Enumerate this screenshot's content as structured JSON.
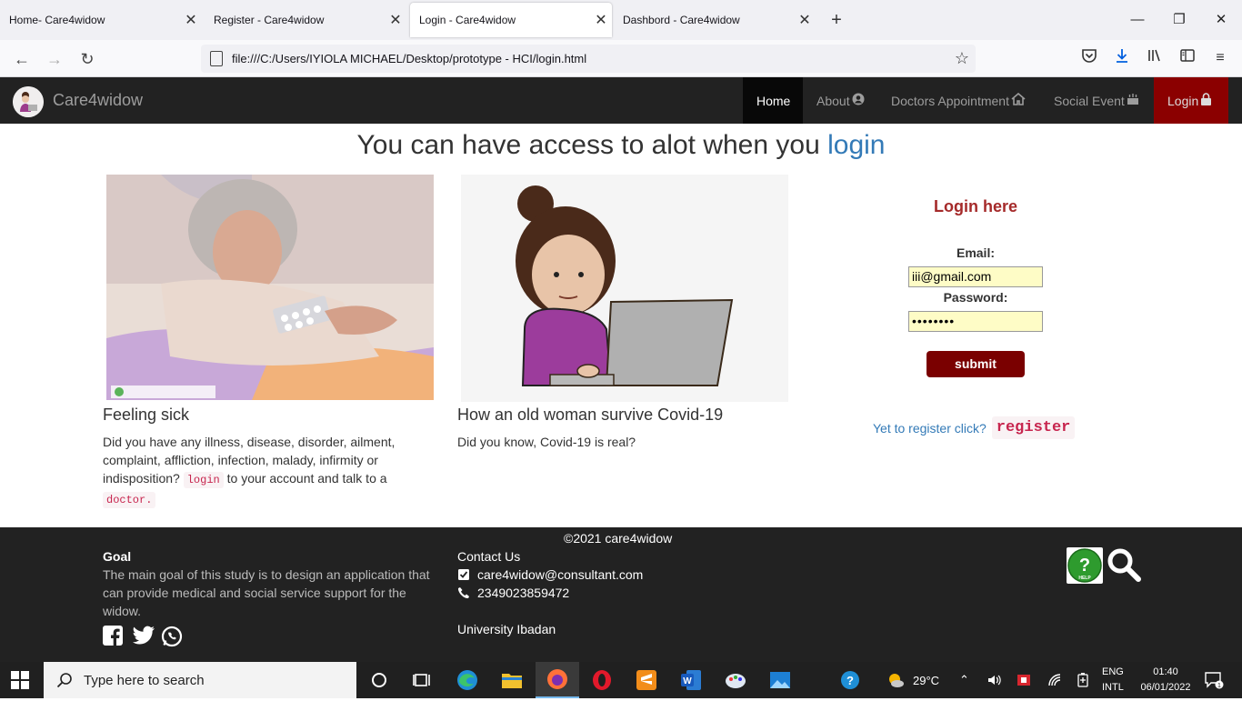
{
  "browser": {
    "tabs": [
      {
        "title": "Home- Care4widow",
        "active": false
      },
      {
        "title": "Register - Care4widow",
        "active": false
      },
      {
        "title": "Login - Care4widow",
        "active": true
      },
      {
        "title": "Dashbord - Care4widow",
        "active": false
      }
    ],
    "url": "file:///C:/Users/IYIOLA MICHAEL/Desktop/prototype - HCI/login.html"
  },
  "site": {
    "brand": "Care4widow",
    "menu": {
      "home": "Home",
      "about": "About",
      "doctors": "Doctors Appointment",
      "social": "Social Event",
      "login": "Login"
    }
  },
  "hero": {
    "title_prefix": "You can have access to alot when you ",
    "title_highlight": "login"
  },
  "cards": {
    "sick": {
      "title": "Feeling sick",
      "text_before": "Did you have any illness, disease, disorder, ailment, complaint, affliction, infection, malady, infirmity or indisposition?",
      "code_login": "login",
      "text_after": "to your account and talk to a",
      "code_doctor": "doctor."
    },
    "covid": {
      "title": "How an old woman survive Covid-19",
      "text": "Did you know, Covid-19 is real?"
    }
  },
  "login_form": {
    "heading": "Login here",
    "email_label": "Email:",
    "email_value": "iii@gmail.com",
    "password_label": "Password:",
    "password_value": "••••••••",
    "submit_label": "submit",
    "register_prompt": "Yet to register click?",
    "register_link": "register"
  },
  "footer": {
    "copyright": "©2021 care4widow",
    "goal_title": "Goal",
    "goal_text": "The main goal of this study is to design an application that can provide medical and social service support for the widow.",
    "contact_title": "Contact Us",
    "email": "care4widow@consultant.com",
    "phone": "2349023859472",
    "university": "University Ibadan"
  },
  "taskbar": {
    "search_placeholder": "Type here to search",
    "temperature": "29°C",
    "lang_top": "ENG",
    "lang_bottom": "INTL",
    "time": "01:40",
    "date": "06/01/2022"
  },
  "colors": {
    "nav_bg": "#222222",
    "login_menu_bg": "#8b0000",
    "submit_bg": "#7a0000",
    "link_blue": "#337ab7",
    "input_bg": "#fefcc6"
  }
}
